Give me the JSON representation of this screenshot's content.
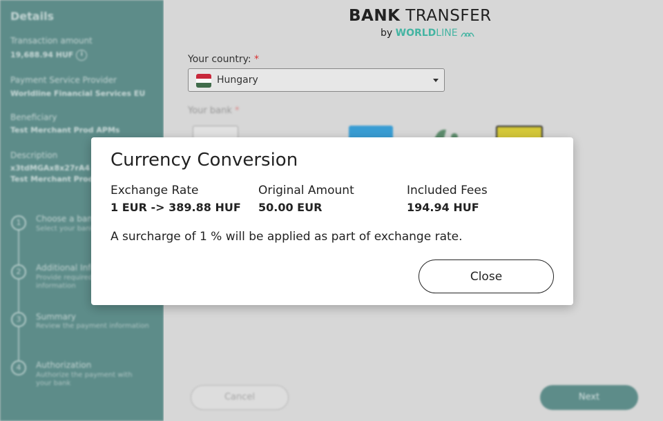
{
  "sidebar": {
    "heading": "Details",
    "transaction_amount_label": "Transaction amount",
    "transaction_amount_value": "19,688.94 HUF",
    "psp_label": "Payment Service Provider",
    "psp_value": "Worldline Financial Services EU",
    "beneficiary_label": "Beneficiary",
    "beneficiary_value": "Test Merchant Prod APMs",
    "description_label": "Description",
    "description_line1": "x3tdMGAx8x27rA4",
    "description_line2": "Test Merchant Prod",
    "steps": [
      {
        "num": "1",
        "title": "Choose a bank",
        "sub": "Select your bank"
      },
      {
        "num": "2",
        "title": "Additional Info",
        "sub": "Provide required",
        "sub2": "information"
      },
      {
        "num": "3",
        "title": "Summary",
        "sub": "Review the payment information"
      },
      {
        "num": "4",
        "title": "Authorization",
        "sub": "Authorize the payment with",
        "sub2": "your bank"
      }
    ]
  },
  "brand": {
    "title_bold": "BANK",
    "title_rest": " TRANSFER",
    "by": "by ",
    "worldline_a": "WORLD",
    "worldline_b": "LINE"
  },
  "form": {
    "country_label": "Your country:",
    "required_mark": "*",
    "country_value": "Hungary",
    "bank_label": "Your bank",
    "cancel_label": "Cancel",
    "next_label": "Next"
  },
  "modal": {
    "title": "Currency Conversion",
    "exchange_rate_label": "Exchange Rate",
    "exchange_rate_value": "1 EUR -> 389.88 HUF",
    "original_amount_label": "Original Amount",
    "original_amount_value": "50.00 EUR",
    "included_fees_label": "Included Fees",
    "included_fees_value": "194.94 HUF",
    "surcharge_text": "A surcharge of 1 % will be applied as part of exchange rate.",
    "close_label": "Close"
  },
  "colors": {
    "sidebar_bg": "#5f8f8c",
    "brand_accent": "#46b8a6",
    "required": "#dd3333",
    "flag_red": "#cd2a3e",
    "flag_white": "#ffffff",
    "flag_green": "#436f4d"
  }
}
